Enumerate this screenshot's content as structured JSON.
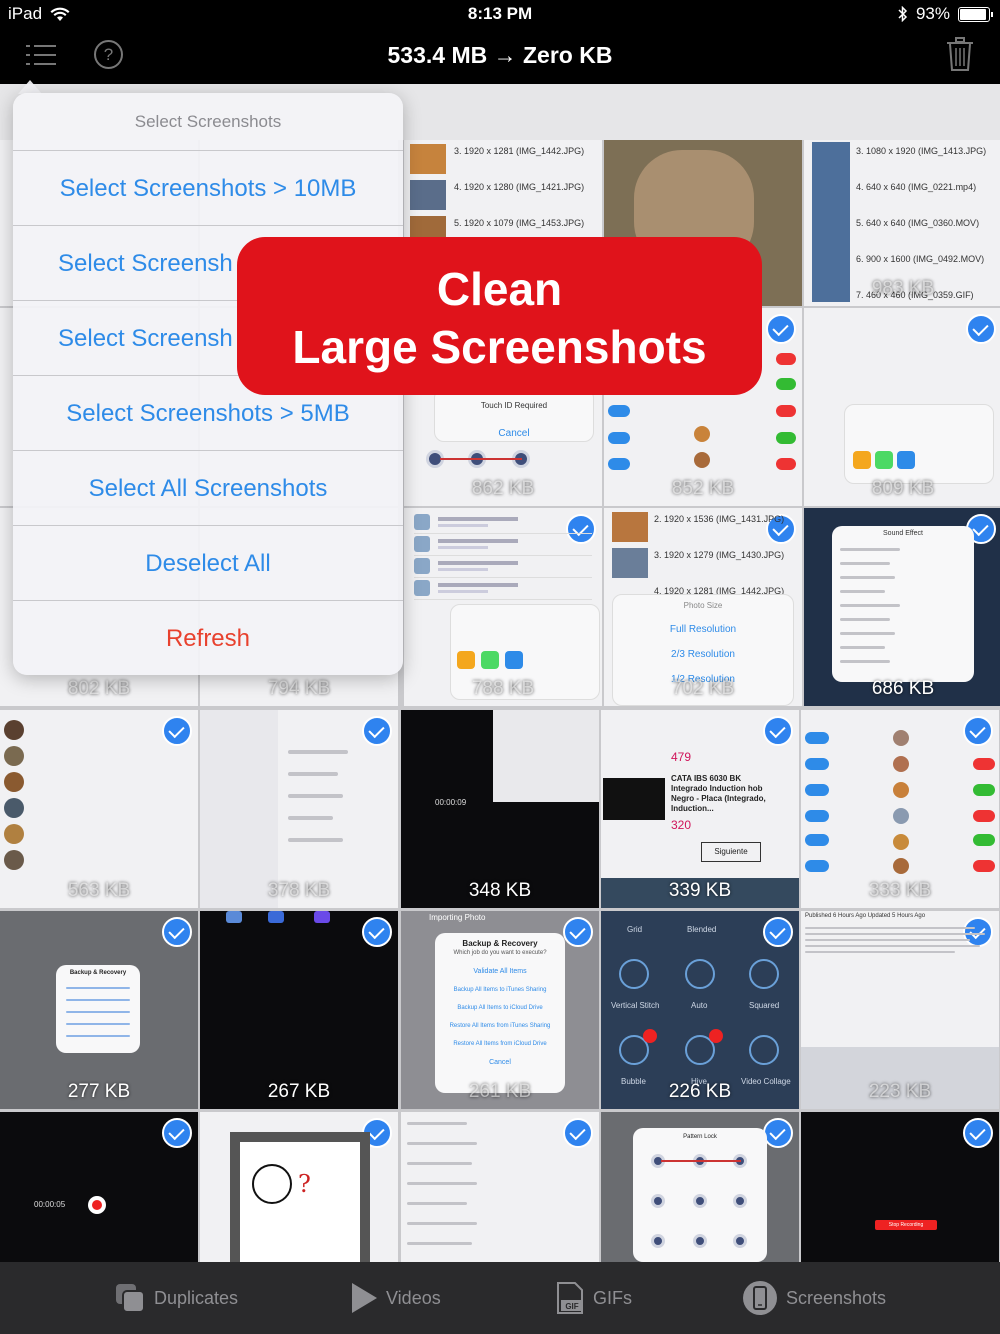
{
  "status_bar": {
    "device": "iPad",
    "time": "8:13 PM",
    "battery": "93%"
  },
  "navbar": {
    "title": "533.4 MB → Zero KB"
  },
  "menu": {
    "header": "Select Screenshots",
    "items": [
      "Select Screenshots > 10MB",
      "Select Screensh",
      "Select Screensh",
      "Select Screenshots > 5MB",
      "Select All Screenshots",
      "Deselect All"
    ],
    "refresh": "Refresh"
  },
  "banner": {
    "line1": "Clean",
    "line2": "Large Screenshots"
  },
  "tiles": {
    "r1": [
      "",
      "",
      "983 KB"
    ],
    "r2": [
      "862 KB",
      "852 KB",
      "809 KB"
    ],
    "r3": [
      "802 KB",
      "794 KB",
      "788 KB",
      "702 KB",
      "686 KB"
    ],
    "r4": [
      "563 KB",
      "378 KB",
      "348 KB",
      "339 KB",
      "333 KB"
    ],
    "r5": [
      "277 KB",
      "267 KB",
      "261 KB",
      "226 KB",
      "223 KB"
    ]
  },
  "tile_text": {
    "r1c3_lines": [
      "3. 1920 x 1281 (IMG_1442.JPG)",
      "4. 1920 x 1280 (IMG_1421.JPG)",
      "5. 1920 x 1079 (IMG_1453.JPG)"
    ],
    "r1c5_lines": [
      "3. 1080 x 1920 (IMG_1413.JPG)",
      "4. 640 x 640 (IMG_0221.mp4)",
      "5. 640 x 640 (IMG_0360.MOV)",
      "6. 900 x 1600 (IMG_0492.MOV)",
      "7. 460 x 460 (IMG_0359.GIF)"
    ],
    "r2c3_touch": "Touch ID Required",
    "r2c3_cancel": "Cancel",
    "r3c4_lines": [
      "2. 1920 x 1536 (IMG_1431.JPG)",
      "3. 1920 x 1279 (IMG_1430.JPG)",
      "4. 1920 x 1281 (IMG_1442.JPG)"
    ],
    "r3c4_photo_size": "Photo Size",
    "r3c4_options": [
      "Full Resolution",
      "2/3 Resolution",
      "1/2 Resolution"
    ],
    "r3c5_title": "Sound Effect",
    "r4c3_time": "00:00:09",
    "r4c4_price1": "479",
    "r4c4_product": "CATA IBS 6030 BK Integrado Induction hob Negro - Placa (Integrado, Induction...",
    "r4c4_price2": "320",
    "r4c4_next": "Siguiente",
    "r5c1_dialog": "Backup & Recovery",
    "r5c3_dialog_title": "Backup & Recovery",
    "r5c3_dialog_sub": "Which job do you want to execute?",
    "r5c3_options": [
      "Validate All Items",
      "Backup All Items to iTunes Sharing",
      "Backup All Items to iCloud Drive",
      "Restore All Items from iTunes Sharing",
      "Restore All Items from iCloud Drive"
    ],
    "r5c3_cancel": "Cancel",
    "r5c3_header": "Importing Photo",
    "r5c4_labels": [
      "Grid",
      "Blended",
      "Vertical Stitch",
      "Auto",
      "Squared",
      "Bubble",
      "Hive",
      "Video Collage"
    ],
    "r5c5_headline": "Published 6 Hours Ago  Updated 5 Hours Ago",
    "r6c1_time": "00:00:05",
    "r6c4_title": "Pattern Lock",
    "r6c5_btn": "Stop Recording"
  },
  "tabbar": {
    "items": [
      "Duplicates",
      "Videos",
      "GIFs",
      "Screenshots"
    ]
  },
  "colors": {
    "accent_blue": "#2e8be8",
    "refresh_red": "#e8412e",
    "banner_red": "#e0131b",
    "check_blue": "#2f83ef"
  }
}
